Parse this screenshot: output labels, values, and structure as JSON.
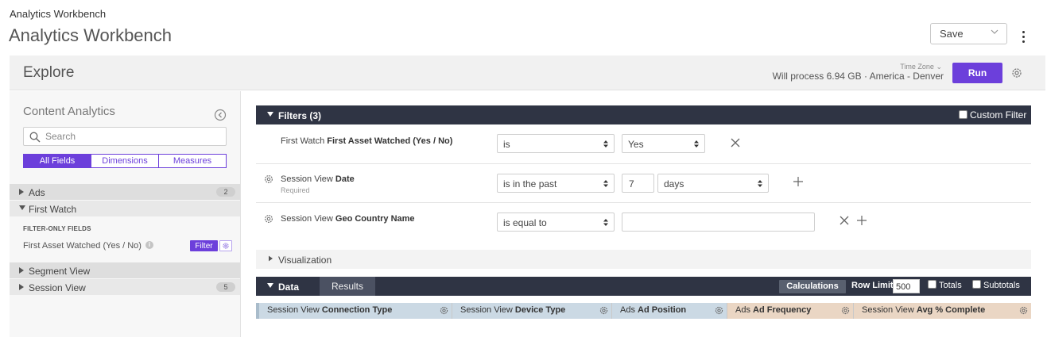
{
  "app": {
    "breadcrumb": "Analytics Workbench",
    "title": "Analytics Workbench",
    "save_label": "Save"
  },
  "explore": {
    "title": "Explore",
    "timezone_label": "Time Zone",
    "process_text": "Will process 6.94 GB · America - Denver",
    "run_label": "Run"
  },
  "sidebar": {
    "title": "Content Analytics",
    "search_placeholder": "Search",
    "tabs": [
      "All Fields",
      "Dimensions",
      "Measures"
    ],
    "views": [
      {
        "label": "Ads",
        "count": "2"
      },
      {
        "label": "First Watch"
      },
      {
        "label": "Segment View"
      },
      {
        "label": "Session View",
        "count": "5"
      }
    ],
    "filter_only_heading": "FILTER-ONLY FIELDS",
    "filter_only_field": "First Asset Watched (Yes / No)",
    "filter_button": "Filter"
  },
  "filters": {
    "header": "Filters (3)",
    "custom_filter_label": "Custom Filter",
    "rows": [
      {
        "view": "First Watch",
        "field": "First Asset Watched (Yes / No)",
        "operator": "is",
        "value": "Yes"
      },
      {
        "view": "Session View",
        "field": "Date",
        "note": "Required",
        "operator": "is in the past",
        "value": "7",
        "unit": "days"
      },
      {
        "view": "Session View",
        "field": "Geo Country Name",
        "operator": "is equal to",
        "value": ""
      }
    ]
  },
  "visualization": {
    "label": "Visualization"
  },
  "data": {
    "tab_data": "Data",
    "tab_results": "Results",
    "calculations": "Calculations",
    "row_limit_label": "Row Limit",
    "row_limit_value": "500",
    "totals_label": "Totals",
    "subtotals_label": "Subtotals",
    "columns": [
      {
        "view": "Session View",
        "field": "Connection Type",
        "kind": "dimension"
      },
      {
        "view": "Session View",
        "field": "Device Type",
        "kind": "dimension"
      },
      {
        "view": "Ads",
        "field": "Ad Position",
        "kind": "dimension"
      },
      {
        "view": "Ads",
        "field": "Ad Frequency",
        "kind": "measure"
      },
      {
        "view": "Session View",
        "field": "Avg % Complete",
        "kind": "measure"
      }
    ]
  },
  "colors": {
    "accent": "#6c3fdb",
    "section_bar": "#2f3444",
    "dimension_col": "#cbd9e4",
    "measure_col": "#ead6c4"
  }
}
